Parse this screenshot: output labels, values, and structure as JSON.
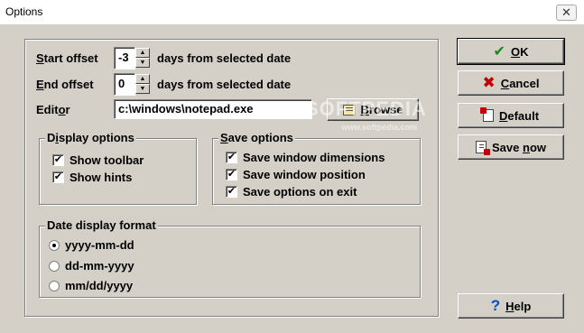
{
  "window": {
    "title": "Options",
    "close_glyph": "✕"
  },
  "start_offset": {
    "label_u": "S",
    "label_rest": "tart offset",
    "value": "-3",
    "suffix": "days from selected date"
  },
  "end_offset": {
    "label_u": "E",
    "label_rest": "nd offset",
    "value": "0",
    "suffix": "days from selected date"
  },
  "editor": {
    "label_pre": "Edit",
    "label_u": "o",
    "label_rest": "r",
    "value": "c:\\windows\\notepad.exe",
    "browse_u": "B",
    "browse_rest": "rowse"
  },
  "display_options": {
    "legend_pre": "D",
    "legend_u": "i",
    "legend_rest": "splay options",
    "items": [
      {
        "label": "Show toolbar",
        "checked": true
      },
      {
        "label": "Show hints",
        "checked": true
      }
    ]
  },
  "save_options": {
    "legend_u": "S",
    "legend_rest": "ave options",
    "items": [
      {
        "label": "Save window dimensions",
        "checked": true
      },
      {
        "label": "Save window position",
        "checked": true
      },
      {
        "label": "Save options on exit",
        "checked": true
      }
    ]
  },
  "date_format": {
    "legend": "Date display format",
    "options": [
      {
        "label": "yyyy-mm-dd",
        "selected": true
      },
      {
        "label": "dd-mm-yyyy",
        "selected": false
      },
      {
        "label": "mm/dd/yyyy",
        "selected": false
      }
    ]
  },
  "buttons": {
    "ok_u": "O",
    "ok_rest": "K",
    "cancel_u": "C",
    "cancel_rest": "ancel",
    "default_u": "D",
    "default_rest": "efault",
    "savenow_pre": "Save ",
    "savenow_u": "n",
    "savenow_rest": "ow",
    "help_u": "H",
    "help_rest": "elp"
  },
  "watermark": {
    "brand": "SOFTPEDIA",
    "url": "www.softpedia.com"
  },
  "colors": {
    "ok_check": "#1a8a1a",
    "cancel_x": "#c00000",
    "help_q": "#0050c0"
  },
  "check_glyph": "✔"
}
